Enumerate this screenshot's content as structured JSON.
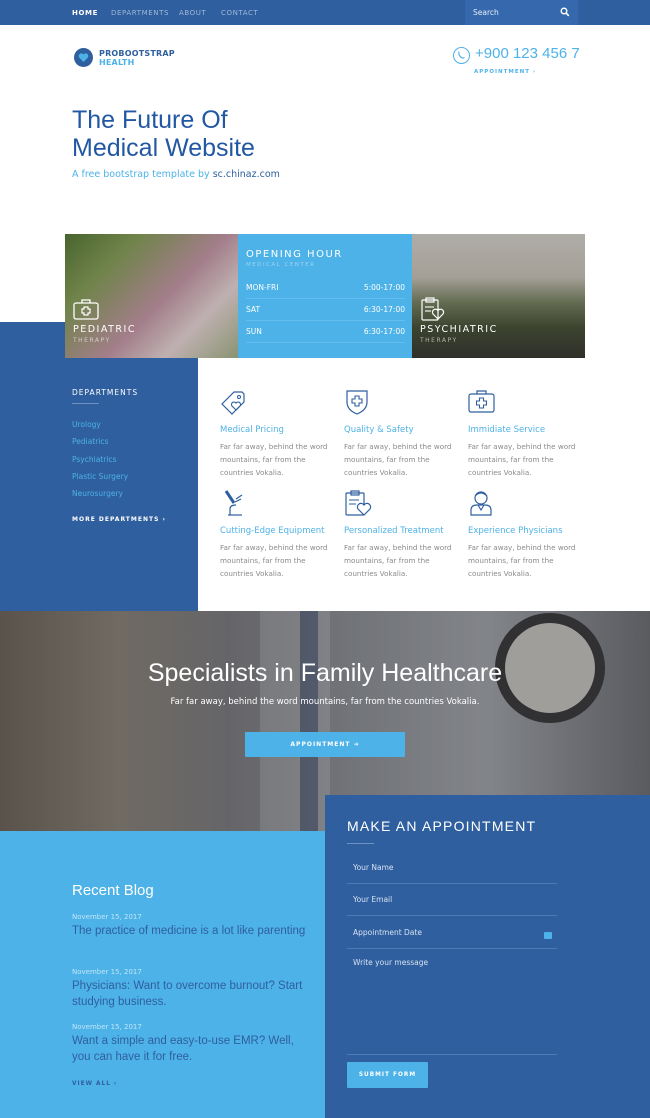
{
  "nav": {
    "items": [
      {
        "label": "HOME",
        "active": true
      },
      {
        "label": "DEPARTMENTS",
        "active": false
      },
      {
        "label": "ABOUT",
        "active": false
      },
      {
        "label": "CONTACT",
        "active": false
      }
    ],
    "search_placeholder": "Search",
    "search_icon": "search-icon"
  },
  "header": {
    "logo_line1": "PROBOOTSTRAP",
    "logo_line2": "HEALTH",
    "logo_icon": "heart-icon",
    "phone": "+900 123 456 7",
    "phone_icon": "phone-icon",
    "appointment_link": "APPOINTMENT ›"
  },
  "hero": {
    "title_line1": "The Future Of",
    "title_line2": "Medical Website",
    "subtitle": "A free bootstrap template by ",
    "subtitle_link": "sc.chinaz.com"
  },
  "cards": {
    "pediatric": {
      "title": "PEDIATRIC",
      "subtitle": "THERAPY",
      "icon": "first-aid-kit-icon"
    },
    "psychiatric": {
      "title": "PSYCHIATRIC",
      "subtitle": "THERAPY",
      "icon": "clipboard-heart-icon"
    }
  },
  "hours": {
    "title": "OPENING HOUR",
    "subtitle": "MEDICAL CENTER",
    "rows": [
      {
        "day": "MON-FRI",
        "time": "5:00-17:00"
      },
      {
        "day": "SAT",
        "time": "6:30-17:00"
      },
      {
        "day": "SUN",
        "time": "6:30-17:00"
      }
    ]
  },
  "departments": {
    "title": "DEPARTMENTS",
    "items": [
      "Urology",
      "Pediatrics",
      "Psychiatrics",
      "Plastic Surgery",
      "Neurosurgery"
    ],
    "more": "MORE DEPARTMENTS ›"
  },
  "services": [
    {
      "title": "Medical Pricing",
      "text": "Far far away, behind the word mountains, far from the countries Vokalia.",
      "icon": "price-tag-heart-icon"
    },
    {
      "title": "Quality & Safety",
      "text": "Far far away, behind the word mountains, far from the countries Vokalia.",
      "icon": "shield-cross-icon"
    },
    {
      "title": "Immidiate Service",
      "text": "Far far away, behind the word mountains, far from the countries Vokalia.",
      "icon": "medical-kit-icon"
    },
    {
      "title": "Cutting-Edge Equipment",
      "text": "Far far away, behind the word mountains, far from the countries Vokalia.",
      "icon": "microscope-icon"
    },
    {
      "title": "Personalized Treatment",
      "text": "Far far away, behind the word mountains, far from the countries Vokalia.",
      "icon": "clipboard-heart-icon"
    },
    {
      "title": "Experience Physicians",
      "text": "Far far away, behind the word mountains, far from the countries Vokalia.",
      "icon": "doctor-icon"
    }
  ],
  "specialists": {
    "title": "Specialists in Family Healthcare",
    "subtitle": "Far far away, behind the word mountains, far from the countries Vokalia.",
    "button": "APPOINTMENT ➔"
  },
  "blog": {
    "title": "Recent Blog",
    "posts": [
      {
        "date": "November 15, 2017",
        "title": "The practice of medicine is a lot like parenting"
      },
      {
        "date": "November 15, 2017",
        "title": "Physicians: Want to overcome burnout? Start studying business."
      },
      {
        "date": "November 15, 2017",
        "title": "Want a simple and easy-to-use EMR? Well, you can have it for free."
      }
    ],
    "view_all": "VIEW ALL ›"
  },
  "appointment": {
    "title": "MAKE AN APPOINTMENT",
    "name_placeholder": "Your Name",
    "email_placeholder": "Your Email",
    "date_placeholder": "Appointment Date",
    "message_placeholder": "Write your message",
    "submit": "SUBMIT FORM"
  },
  "colors": {
    "primary": "#2f5f9e",
    "accent": "#4db2e8"
  }
}
